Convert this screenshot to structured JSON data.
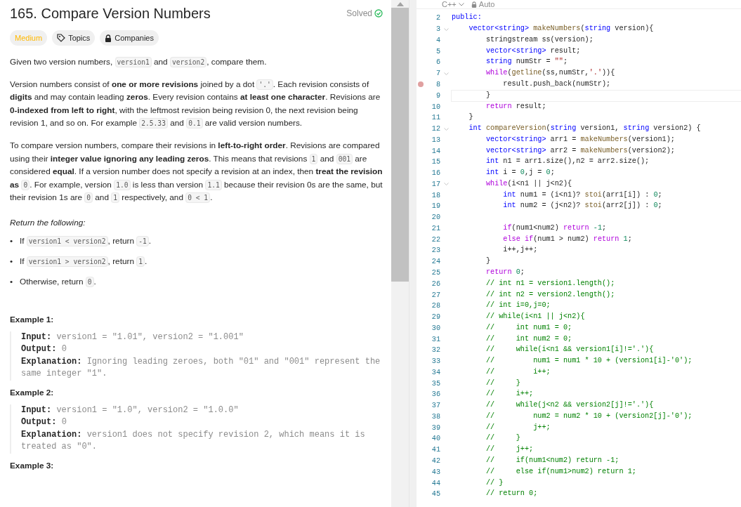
{
  "problem": {
    "title": "165. Compare Version Numbers",
    "status": {
      "label": "Solved",
      "solved": true
    },
    "tags": [
      {
        "kind": "difficulty",
        "label": "Medium"
      },
      {
        "kind": "topics",
        "label": "Topics"
      },
      {
        "kind": "companies",
        "label": "Companies"
      }
    ],
    "paragraphs": [
      {
        "parts": [
          {
            "kind": "text",
            "text": "Given two version numbers, "
          },
          {
            "kind": "code",
            "text": "version1"
          },
          {
            "kind": "text",
            "text": " and "
          },
          {
            "kind": "code",
            "text": "version2"
          },
          {
            "kind": "text",
            "text": ", compare them."
          }
        ]
      },
      {
        "parts": [
          {
            "kind": "text",
            "text": "Version numbers consist of **one or more revisions** joined by a dot "
          },
          {
            "kind": "code",
            "text": "'.'"
          },
          {
            "kind": "text",
            "text": ". Each revision consists of **digits** and may contain leading **zeros**. Every revision contains **at least one character**. Revisions are **0-indexed from left to right**, with the leftmost revision being revision 0, the next revision being revision 1, and so on. For example "
          },
          {
            "kind": "code",
            "text": "2.5.33"
          },
          {
            "kind": "text",
            "text": " and "
          },
          {
            "kind": "code",
            "text": "0.1"
          },
          {
            "kind": "text",
            "text": " are valid version numbers."
          }
        ]
      },
      {
        "parts": [
          {
            "kind": "text",
            "text": "To compare version numbers, compare their revisions in **left-to-right order**. Revisions are compared using their **integer value ignoring any leading zeros**. This means that revisions "
          },
          {
            "kind": "code",
            "text": "1"
          },
          {
            "kind": "text",
            "text": " and "
          },
          {
            "kind": "code",
            "text": "001"
          },
          {
            "kind": "text",
            "text": " are considered **equal**. If a version number does not specify a revision at an index, then **treat the revision as** "
          },
          {
            "kind": "code",
            "text": "0"
          },
          {
            "kind": "text",
            "text": ". For example, version "
          },
          {
            "kind": "code",
            "text": "1.0"
          },
          {
            "kind": "text",
            "text": " is less than version "
          },
          {
            "kind": "code",
            "text": "1.1"
          },
          {
            "kind": "text",
            "text": " because their revision 0s are the same, but their revision 1s are "
          },
          {
            "kind": "code",
            "text": "0"
          },
          {
            "kind": "text",
            "text": " and "
          },
          {
            "kind": "code",
            "text": "1"
          },
          {
            "kind": "text",
            "text": " respectively, and "
          },
          {
            "kind": "code",
            "text": "0 < 1"
          },
          {
            "kind": "text",
            "text": "."
          }
        ]
      }
    ],
    "return_heading": "Return the following:",
    "bullets": [
      {
        "marker": "•",
        "parts": [
          {
            "kind": "text",
            "text": "If "
          },
          {
            "kind": "code",
            "text": "version1 < version2"
          },
          {
            "kind": "text",
            "text": ", return "
          },
          {
            "kind": "code",
            "text": "-1"
          },
          {
            "kind": "text",
            "text": "."
          }
        ]
      },
      {
        "marker": "•",
        "parts": [
          {
            "kind": "text",
            "text": "If "
          },
          {
            "kind": "code",
            "text": "version1 > version2"
          },
          {
            "kind": "text",
            "text": ", return "
          },
          {
            "kind": "code",
            "text": "1"
          },
          {
            "kind": "text",
            "text": "."
          }
        ]
      },
      {
        "marker": "•",
        "parts": [
          {
            "kind": "text",
            "text": "Otherwise, return "
          },
          {
            "kind": "code",
            "text": "0"
          },
          {
            "kind": "text",
            "text": "."
          }
        ]
      }
    ],
    "examples": [
      {
        "title": "Example 1:",
        "lines": [
          {
            "label": "Input:",
            "value": "version1 = \"1.01\", version2 = \"1.001\""
          },
          {
            "label": "Output:",
            "value": "0"
          },
          {
            "label": "Explanation:",
            "value": "Ignoring leading zeroes, both \"01\" and \"001\" represent the same integer \"1\"."
          }
        ]
      },
      {
        "title": "Example 2:",
        "lines": [
          {
            "label": "Input:",
            "value": "version1 = \"1.0\", version2 = \"1.0.0\""
          },
          {
            "label": "Output:",
            "value": "0"
          },
          {
            "label": "Explanation:",
            "value": "version1 does not specify revision 2, which means it is treated as \"0\"."
          }
        ]
      },
      {
        "title": "Example 3:"
      }
    ]
  },
  "editor": {
    "language": "C++",
    "mode": "Auto",
    "lines": [
      {
        "n": "2",
        "code": [
          {
            "kind": "type",
            "text": "public:"
          }
        ]
      },
      {
        "n": "3",
        "fold": true,
        "code": [
          {
            "kind": "type",
            "text": "    vector<string>"
          },
          {
            "kind": "func",
            "text": " makeNumbers"
          },
          {
            "kind": "plain",
            "text": "("
          },
          {
            "kind": "type",
            "text": "string"
          },
          {
            "kind": "plain",
            "text": " version){"
          }
        ]
      },
      {
        "n": "4",
        "code": [
          {
            "kind": "plain",
            "text": "        stringstream ss(version);"
          }
        ]
      },
      {
        "n": "5",
        "code": [
          {
            "kind": "type",
            "text": "        vector<string>"
          },
          {
            "kind": "plain",
            "text": " result;"
          }
        ]
      },
      {
        "n": "6",
        "code": [
          {
            "kind": "type",
            "text": "        string"
          },
          {
            "kind": "plain",
            "text": " numStr = "
          },
          {
            "kind": "str",
            "text": "\"\""
          },
          {
            "kind": "plain",
            "text": ";"
          }
        ]
      },
      {
        "n": "7",
        "fold": true,
        "code": [
          {
            "kind": "keyword",
            "text": "        while"
          },
          {
            "kind": "plain",
            "text": "("
          },
          {
            "kind": "func",
            "text": "getline"
          },
          {
            "kind": "plain",
            "text": "(ss,numStr,"
          },
          {
            "kind": "str",
            "text": "'.'"
          },
          {
            "kind": "plain",
            "text": ")){"
          }
        ]
      },
      {
        "n": "8",
        "breakpoint": true,
        "code": [
          {
            "kind": "plain",
            "text": "            result.push_back(numStr);"
          }
        ]
      },
      {
        "n": "9",
        "current": true,
        "code": [
          {
            "kind": "plain",
            "text": "        }"
          }
        ]
      },
      {
        "n": "10",
        "code": [
          {
            "kind": "keyword",
            "text": "        return"
          },
          {
            "kind": "plain",
            "text": " result;"
          }
        ]
      },
      {
        "n": "11",
        "code": [
          {
            "kind": "plain",
            "text": "    }"
          }
        ]
      },
      {
        "n": "12",
        "fold": true,
        "code": [
          {
            "kind": "type",
            "text": "    int"
          },
          {
            "kind": "func",
            "text": " compareVersion"
          },
          {
            "kind": "plain",
            "text": "("
          },
          {
            "kind": "type",
            "text": "string"
          },
          {
            "kind": "plain",
            "text": " version1, "
          },
          {
            "kind": "type",
            "text": "string"
          },
          {
            "kind": "plain",
            "text": " version2) {"
          }
        ]
      },
      {
        "n": "13",
        "code": [
          {
            "kind": "type",
            "text": "        vector<string>"
          },
          {
            "kind": "plain",
            "text": " arr1 = "
          },
          {
            "kind": "func",
            "text": "makeNumbers"
          },
          {
            "kind": "plain",
            "text": "(version1);"
          }
        ]
      },
      {
        "n": "14",
        "code": [
          {
            "kind": "type",
            "text": "        vector<string>"
          },
          {
            "kind": "plain",
            "text": " arr2 = "
          },
          {
            "kind": "func",
            "text": "makeNumbers"
          },
          {
            "kind": "plain",
            "text": "(version2);"
          }
        ]
      },
      {
        "n": "15",
        "code": [
          {
            "kind": "type",
            "text": "        int"
          },
          {
            "kind": "plain",
            "text": " n1 = arr1.size(),n2 = arr2.size();"
          }
        ]
      },
      {
        "n": "16",
        "code": [
          {
            "kind": "type",
            "text": "        int"
          },
          {
            "kind": "plain",
            "text": " i = "
          },
          {
            "kind": "number",
            "text": "0"
          },
          {
            "kind": "plain",
            "text": ",j = "
          },
          {
            "kind": "number",
            "text": "0"
          },
          {
            "kind": "plain",
            "text": ";"
          }
        ]
      },
      {
        "n": "17",
        "fold": true,
        "code": [
          {
            "kind": "keyword",
            "text": "        while"
          },
          {
            "kind": "plain",
            "text": "(i<n1 || j<n2){"
          }
        ]
      },
      {
        "n": "18",
        "code": [
          {
            "kind": "type",
            "text": "            int"
          },
          {
            "kind": "plain",
            "text": " num1 = (i<n1)? "
          },
          {
            "kind": "func",
            "text": "stoi"
          },
          {
            "kind": "plain",
            "text": "(arr1[i]) : "
          },
          {
            "kind": "number",
            "text": "0"
          },
          {
            "kind": "plain",
            "text": ";"
          }
        ]
      },
      {
        "n": "19",
        "code": [
          {
            "kind": "type",
            "text": "            int"
          },
          {
            "kind": "plain",
            "text": " num2 = (j<n2)? "
          },
          {
            "kind": "func",
            "text": "stoi"
          },
          {
            "kind": "plain",
            "text": "(arr2[j]) : "
          },
          {
            "kind": "number",
            "text": "0"
          },
          {
            "kind": "plain",
            "text": ";"
          }
        ]
      },
      {
        "n": "20"
      },
      {
        "n": "21",
        "code": [
          {
            "kind": "keyword",
            "text": "            if"
          },
          {
            "kind": "plain",
            "text": "(num1<num2) "
          },
          {
            "kind": "keyword",
            "text": "return"
          },
          {
            "kind": "number",
            "text": " -1"
          },
          {
            "kind": "plain",
            "text": ";"
          }
        ]
      },
      {
        "n": "22",
        "code": [
          {
            "kind": "keyword",
            "text": "            else if"
          },
          {
            "kind": "plain",
            "text": "(num1 > num2) "
          },
          {
            "kind": "keyword",
            "text": "return"
          },
          {
            "kind": "number",
            "text": " 1"
          },
          {
            "kind": "plain",
            "text": ";"
          }
        ]
      },
      {
        "n": "23",
        "code": [
          {
            "kind": "plain",
            "text": "            i++,j++;"
          }
        ]
      },
      {
        "n": "24",
        "code": [
          {
            "kind": "plain",
            "text": "        }"
          }
        ]
      },
      {
        "n": "25",
        "code": [
          {
            "kind": "keyword",
            "text": "        return"
          },
          {
            "kind": "number",
            "text": " 0"
          },
          {
            "kind": "plain",
            "text": ";"
          }
        ]
      },
      {
        "n": "26",
        "code": [
          {
            "kind": "comment",
            "text": "        // int n1 = version1.length();"
          }
        ]
      },
      {
        "n": "27",
        "code": [
          {
            "kind": "comment",
            "text": "        // int n2 = version2.length();"
          }
        ]
      },
      {
        "n": "28",
        "code": [
          {
            "kind": "comment",
            "text": "        // int i=0,j=0;"
          }
        ]
      },
      {
        "n": "29",
        "code": [
          {
            "kind": "comment",
            "text": "        // while(i<n1 || j<n2){"
          }
        ]
      },
      {
        "n": "30",
        "code": [
          {
            "kind": "comment",
            "text": "        //     int num1 = 0;"
          }
        ]
      },
      {
        "n": "31",
        "code": [
          {
            "kind": "comment",
            "text": "        //     int num2 = 0;"
          }
        ]
      },
      {
        "n": "32",
        "code": [
          {
            "kind": "comment",
            "text": "        //     while(i<n1 && version1[i]!='.'){"
          }
        ]
      },
      {
        "n": "33",
        "code": [
          {
            "kind": "comment",
            "text": "        //         num1 = num1 * 10 + (version1[i]-'0');"
          }
        ]
      },
      {
        "n": "34",
        "code": [
          {
            "kind": "comment",
            "text": "        //         i++;"
          }
        ]
      },
      {
        "n": "35",
        "code": [
          {
            "kind": "comment",
            "text": "        //     }"
          }
        ]
      },
      {
        "n": "36",
        "code": [
          {
            "kind": "comment",
            "text": "        //     i++;"
          }
        ]
      },
      {
        "n": "37",
        "code": [
          {
            "kind": "comment",
            "text": "        //     while(j<n2 && version2[j]!='.'){"
          }
        ]
      },
      {
        "n": "38",
        "code": [
          {
            "kind": "comment",
            "text": "        //         num2 = num2 * 10 + (version2[j]-'0');"
          }
        ]
      },
      {
        "n": "39",
        "code": [
          {
            "kind": "comment",
            "text": "        //         j++;"
          }
        ]
      },
      {
        "n": "40",
        "code": [
          {
            "kind": "comment",
            "text": "        //     }"
          }
        ]
      },
      {
        "n": "41",
        "code": [
          {
            "kind": "comment",
            "text": "        //     j++;"
          }
        ]
      },
      {
        "n": "42",
        "code": [
          {
            "kind": "comment",
            "text": "        //     if(num1<num2) return -1;"
          }
        ]
      },
      {
        "n": "43",
        "code": [
          {
            "kind": "comment",
            "text": "        //     else if(num1>num2) return 1;"
          }
        ]
      },
      {
        "n": "44",
        "code": [
          {
            "kind": "comment",
            "text": "        // }"
          }
        ]
      },
      {
        "n": "45",
        "code": [
          {
            "kind": "comment",
            "text": "        // return 0;"
          }
        ]
      }
    ]
  }
}
